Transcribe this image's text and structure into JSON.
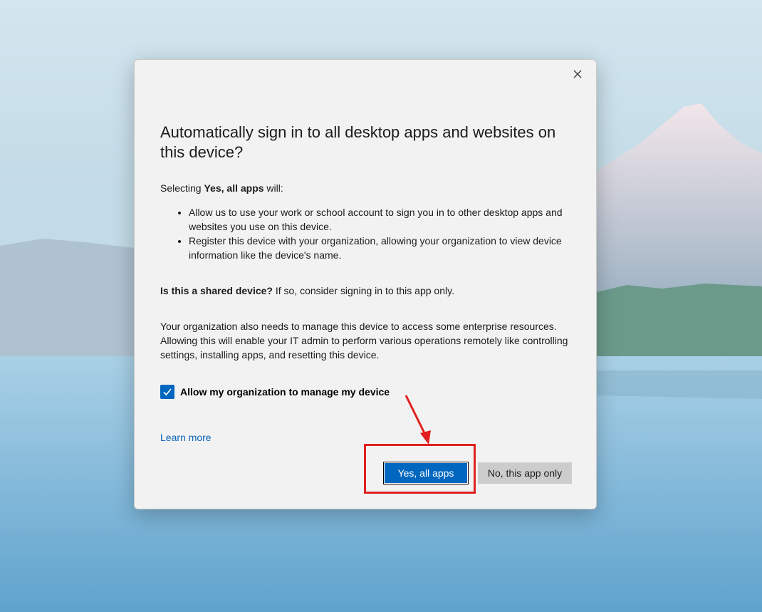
{
  "dialog": {
    "title": "Automatically sign in to all desktop apps and websites on this device?",
    "intro_prefix": "Selecting ",
    "intro_bold": "Yes, all apps",
    "intro_suffix": " will:",
    "bullets": [
      "Allow us to use your work or school account to sign you in to other desktop apps and websites you use on this device.",
      "Register this device with your organization, allowing your organization to view device information like the device's name."
    ],
    "shared_bold": "Is this a shared device?",
    "shared_rest": " If so, consider signing in to this app only.",
    "manage_text": "Your organization also needs to manage this device to access some enterprise resources. Allowing this will enable your IT admin to perform various operations remotely like controlling settings, installing apps, and resetting this device.",
    "checkbox_label": "Allow my organization to manage my device",
    "checkbox_checked": true,
    "learn_more": "Learn more",
    "primary_button": "Yes, all apps",
    "secondary_button": "No, this app only"
  },
  "colors": {
    "accent": "#0067c0",
    "link": "#0a64b8",
    "annotation": "#e02020"
  },
  "icons": {
    "close": "close-icon",
    "check": "checkmark-icon"
  }
}
